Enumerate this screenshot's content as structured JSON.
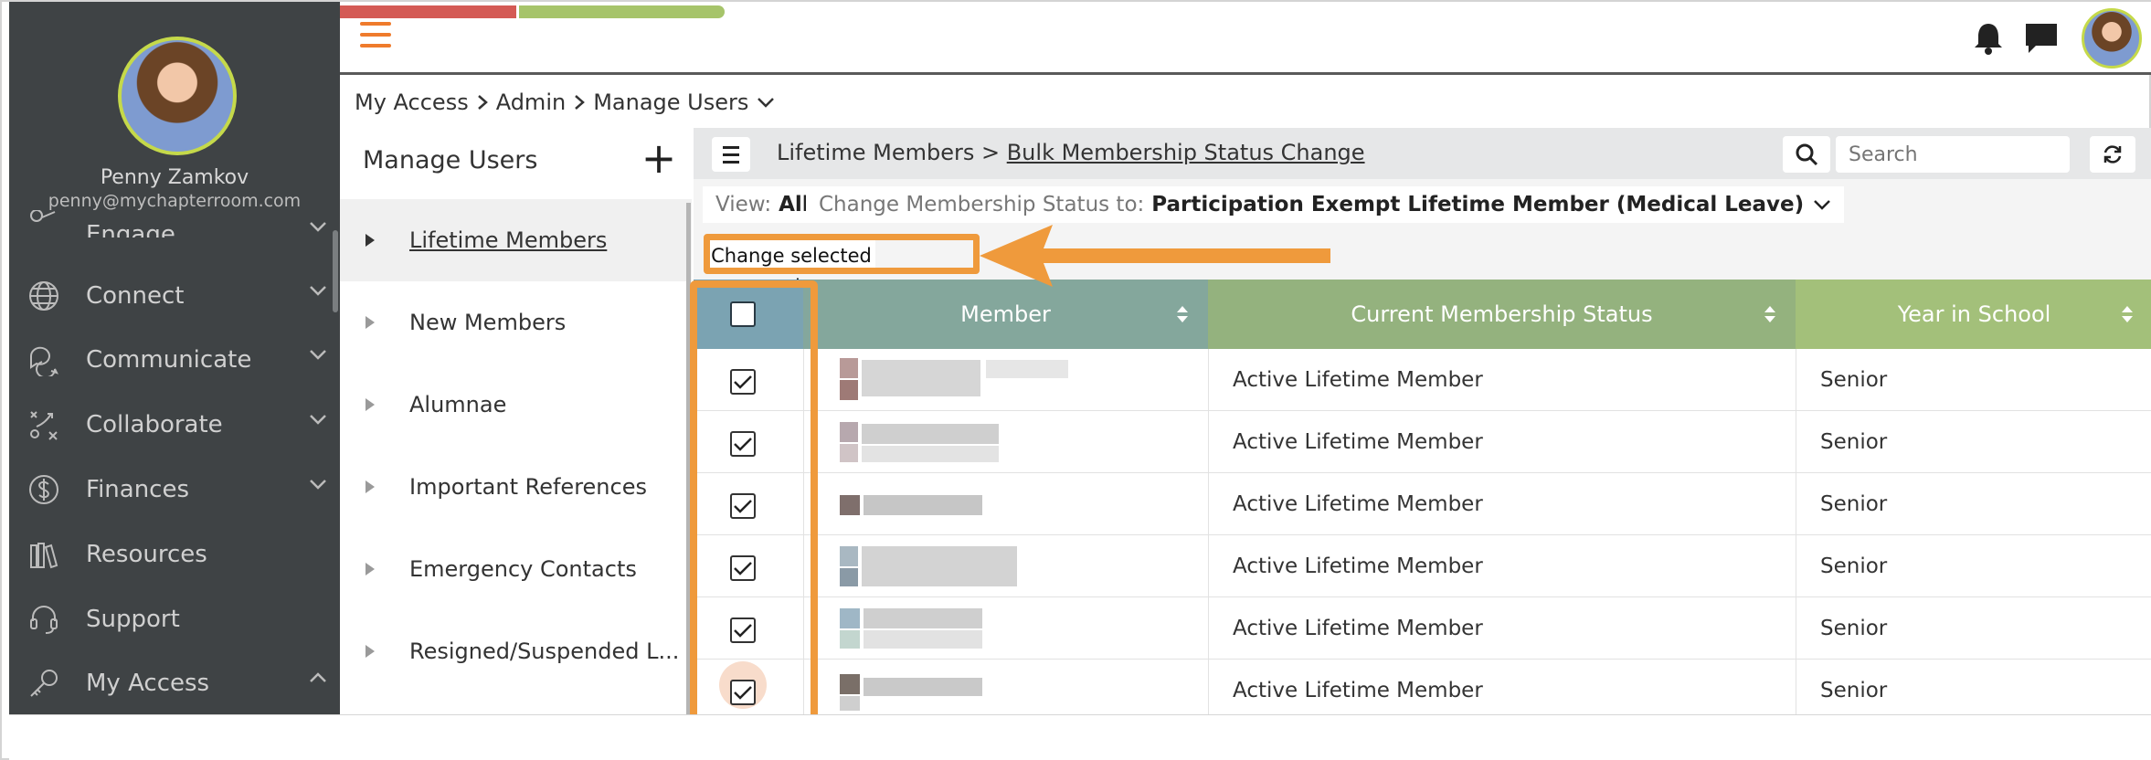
{
  "sidebar": {
    "user_name": "Penny Zamkov",
    "user_email": "penny@mychapterroom.com",
    "partial_item": "Engage",
    "items": [
      {
        "label": "Connect",
        "icon": "globe-icon",
        "expand": "down"
      },
      {
        "label": "Communicate",
        "icon": "chat-bubbles-icon",
        "expand": "down"
      },
      {
        "label": "Collaborate",
        "icon": "strategy-icon",
        "expand": "down"
      },
      {
        "label": "Finances",
        "icon": "dollar-icon",
        "expand": "down"
      },
      {
        "label": "Resources",
        "icon": "books-icon",
        "expand": ""
      },
      {
        "label": "Support",
        "icon": "headset-icon",
        "expand": ""
      },
      {
        "label": "My Access",
        "icon": "key-icon",
        "expand": "up"
      }
    ]
  },
  "topbar": {
    "progress_colors": [
      "#d45a55",
      "#a6c46a"
    ],
    "menu_icon": "hamburger-icon",
    "icons": [
      "bell-icon",
      "chat-icon"
    ]
  },
  "breadcrumb": [
    "My Access",
    "Admin",
    "Manage Users"
  ],
  "tree": {
    "title": "Manage Users",
    "items": [
      {
        "label": "Lifetime Members",
        "active": true
      },
      {
        "label": "New Members",
        "active": false
      },
      {
        "label": "Alumnae",
        "active": false
      },
      {
        "label": "Important References",
        "active": false
      },
      {
        "label": "Emergency Contacts",
        "active": false
      },
      {
        "label": "Resigned/Suspended L...",
        "active": false
      }
    ]
  },
  "main": {
    "crumb_root": "Lifetime Members",
    "crumb_sep": ">",
    "crumb_current": "Bulk Membership Status Change",
    "search_placeholder": "Search",
    "view_label": "View:",
    "view_value": "All",
    "change_label": "Change Membership Status to:",
    "change_value": "Participation Exempt Lifetime Member (Medical Leave)",
    "change_selected_button": "Change selected only"
  },
  "table": {
    "columns": [
      "Member",
      "Current Membership Status",
      "Year in School"
    ],
    "column_colors": [
      "#7ba3b2",
      "#84a79c",
      "#94b27e",
      "#a3c07a"
    ],
    "rows": [
      {
        "checked": true,
        "status": "Active Lifetime Member",
        "year": "Senior"
      },
      {
        "checked": true,
        "status": "Active Lifetime Member",
        "year": "Senior"
      },
      {
        "checked": true,
        "status": "Active Lifetime Member",
        "year": "Senior"
      },
      {
        "checked": true,
        "status": "Active Lifetime Member",
        "year": "Senior"
      },
      {
        "checked": true,
        "status": "Active Lifetime Member",
        "year": "Senior"
      },
      {
        "checked": true,
        "status": "Active Lifetime Member",
        "year": "Senior"
      }
    ]
  },
  "colors": {
    "sidebar_bg": "#3f4345",
    "accent_orange": "#ef9a3c",
    "avatar_ring": "#c5d94a"
  }
}
